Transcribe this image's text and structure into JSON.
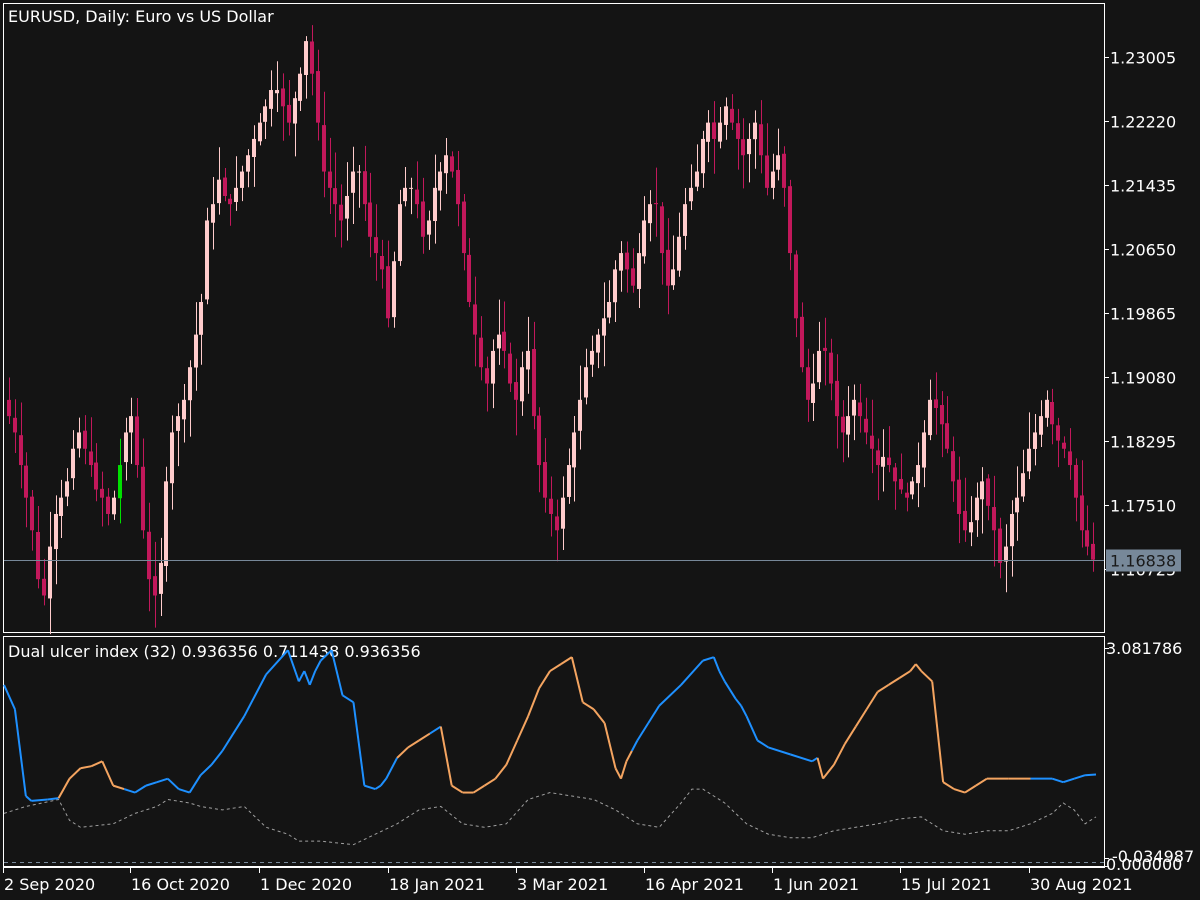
{
  "window": {
    "symbol_title": "EURUSD, Daily:  Euro vs US Dollar"
  },
  "colors": {
    "background": "#141414",
    "frame": "#ffffff",
    "bull_candle": "#ffcccc",
    "bear_candle": "#c2185b",
    "doji_candle": "#00e000",
    "price_line": "#778899",
    "price_tag_bg": "#778899",
    "ulcer_up": "#1e90ff",
    "ulcer_down": "#f4a460",
    "ulcer_dotted": "#a0a0a0",
    "zero_line": "#778899"
  },
  "indicator": {
    "label": "Dual ulcer index (32) 0.936356 0.711438 0.936356",
    "name": "Dual ulcer index",
    "period": 32,
    "values": [
      0.936356,
      0.711438,
      0.936356
    ]
  },
  "chart_data": [
    {
      "type": "candlestick",
      "title": "EURUSD, Daily:  Euro vs US Dollar",
      "ylabel": "",
      "ylim": [
        1.1602,
        1.2375
      ],
      "yticks": [
        "1.23005",
        "1.22220",
        "1.21435",
        "1.20650",
        "1.19865",
        "1.19080",
        "1.18295",
        "1.17510",
        "1.16725"
      ],
      "ytick_values": [
        1.23005,
        1.2222,
        1.21435,
        1.2065,
        1.19865,
        1.1908,
        1.18295,
        1.1751,
        1.16725
      ],
      "current_price": "1.16838",
      "current_price_value": 1.16838,
      "xticks": [
        "2 Sep 2020",
        "16 Oct 2020",
        "1 Dec 2020",
        "18 Jan 2021",
        "3 Mar 2021",
        "16 Apr 2021",
        "1 Jun 2021",
        "15 Jul 2021",
        "30 Aug 2021"
      ],
      "grid": false,
      "close_path": [
        1.186,
        1.184,
        1.18,
        1.176,
        1.172,
        1.166,
        1.164,
        1.17,
        1.174,
        1.176,
        1.178,
        1.182,
        1.184,
        1.182,
        1.18,
        1.177,
        1.176,
        1.174,
        1.176,
        1.18,
        1.184,
        1.186,
        1.18,
        1.172,
        1.166,
        1.164,
        1.168,
        1.178,
        1.184,
        1.186,
        1.188,
        1.192,
        1.196,
        1.2,
        1.21,
        1.212,
        1.215,
        1.213,
        1.212,
        1.214,
        1.216,
        1.218,
        1.22,
        1.222,
        1.224,
        1.226,
        1.226,
        1.224,
        1.222,
        1.225,
        1.228,
        1.232,
        1.228,
        1.222,
        1.216,
        1.214,
        1.212,
        1.21,
        1.213,
        1.216,
        1.216,
        1.212,
        1.208,
        1.206,
        1.204,
        1.198,
        1.205,
        1.212,
        1.214,
        1.214,
        1.212,
        1.208,
        1.21,
        1.214,
        1.216,
        1.218,
        1.216,
        1.212,
        1.206,
        1.2,
        1.196,
        1.192,
        1.19,
        1.194,
        1.196,
        1.194,
        1.19,
        1.188,
        1.192,
        1.194,
        1.186,
        1.18,
        1.176,
        1.174,
        1.172,
        1.176,
        1.18,
        1.184,
        1.188,
        1.192,
        1.194,
        1.196,
        1.198,
        1.2,
        1.204,
        1.206,
        1.204,
        1.202,
        1.206,
        1.21,
        1.212,
        1.212,
        1.206,
        1.202,
        1.204,
        1.208,
        1.212,
        1.214,
        1.216,
        1.22,
        1.222,
        1.22,
        1.222,
        1.224,
        1.222,
        1.22,
        1.218,
        1.22,
        1.222,
        1.218,
        1.214,
        1.216,
        1.218,
        1.214,
        1.206,
        1.198,
        1.192,
        1.188,
        1.19,
        1.194,
        1.194,
        1.19,
        1.186,
        1.184,
        1.186,
        1.188,
        1.186,
        1.184,
        1.182,
        1.18,
        1.181,
        1.18,
        1.178,
        1.177,
        1.176,
        1.178,
        1.18,
        1.184,
        1.188,
        1.187,
        1.185,
        1.182,
        1.178,
        1.174,
        1.172,
        1.173,
        1.176,
        1.178,
        1.175,
        1.172,
        1.168,
        1.17,
        1.174,
        1.176,
        1.179,
        1.182,
        1.184,
        1.186,
        1.188,
        1.185,
        1.183,
        1.182,
        1.18,
        1.176,
        1.172,
        1.17,
        1.1684
      ]
    },
    {
      "type": "line",
      "title": "Dual ulcer index (32) 0.936356 0.711438 0.936356",
      "ylim": [
        -0.034987,
        3.081786
      ],
      "yticks": [
        "3.081786",
        "-0.034987",
        "0.000000"
      ],
      "ytick_values": [
        3.081786,
        -0.034987,
        0.0
      ],
      "series": [
        {
          "name": "ulcer (up-colored blue / down-colored orange)",
          "x_fraction": [
            0.0,
            0.01,
            0.02,
            0.025,
            0.04,
            0.05,
            0.06,
            0.07,
            0.08,
            0.09,
            0.1,
            0.11,
            0.12,
            0.13,
            0.14,
            0.15,
            0.16,
            0.17,
            0.18,
            0.19,
            0.2,
            0.22,
            0.24,
            0.26,
            0.27,
            0.275,
            0.28,
            0.285,
            0.29,
            0.3,
            0.31,
            0.32,
            0.33,
            0.34,
            0.345,
            0.35,
            0.36,
            0.37,
            0.38,
            0.39,
            0.4,
            0.41,
            0.42,
            0.43,
            0.44,
            0.45,
            0.46,
            0.47,
            0.48,
            0.49,
            0.5,
            0.51,
            0.52,
            0.53,
            0.54,
            0.55,
            0.56,
            0.565,
            0.57,
            0.575,
            0.58,
            0.59,
            0.6,
            0.62,
            0.64,
            0.65,
            0.655,
            0.66,
            0.67,
            0.675,
            0.68,
            0.69,
            0.7,
            0.72,
            0.74,
            0.745,
            0.75,
            0.76,
            0.77,
            0.78,
            0.79,
            0.8,
            0.81,
            0.82,
            0.83,
            0.835,
            0.84,
            0.85,
            0.86,
            0.87,
            0.88,
            0.89,
            0.9,
            0.92,
            0.94,
            0.96,
            0.97,
            0.98,
            0.99,
            1.0
          ],
          "values": [
            2.55,
            2.2,
            0.95,
            0.88,
            0.9,
            0.92,
            1.2,
            1.35,
            1.38,
            1.45,
            1.1,
            1.05,
            1.0,
            1.1,
            1.15,
            1.2,
            1.05,
            1.0,
            1.25,
            1.4,
            1.6,
            2.1,
            2.7,
            3.05,
            2.6,
            2.75,
            2.55,
            2.75,
            2.9,
            3.05,
            2.4,
            2.3,
            1.1,
            1.05,
            1.1,
            1.2,
            1.5,
            1.65,
            1.75,
            1.85,
            1.95,
            1.1,
            1.0,
            1.0,
            1.1,
            1.2,
            1.4,
            1.75,
            2.1,
            2.5,
            2.75,
            2.85,
            2.95,
            2.3,
            2.2,
            2.0,
            1.35,
            1.2,
            1.45,
            1.6,
            1.75,
            2.0,
            2.25,
            2.55,
            2.9,
            2.95,
            2.75,
            2.6,
            2.35,
            2.25,
            2.1,
            1.75,
            1.65,
            1.55,
            1.45,
            1.5,
            1.2,
            1.4,
            1.7,
            1.95,
            2.2,
            2.45,
            2.55,
            2.65,
            2.75,
            2.85,
            2.75,
            2.6,
            1.15,
            1.05,
            1.0,
            1.1,
            1.2,
            1.2,
            1.2,
            1.2,
            1.15,
            1.2,
            1.25,
            1.26
          ]
        },
        {
          "name": "ulcer baseline (dotted)",
          "x_fraction": [
            0.0,
            0.02,
            0.05,
            0.06,
            0.07,
            0.1,
            0.12,
            0.14,
            0.15,
            0.17,
            0.18,
            0.2,
            0.22,
            0.24,
            0.26,
            0.27,
            0.29,
            0.32,
            0.34,
            0.36,
            0.38,
            0.4,
            0.42,
            0.44,
            0.46,
            0.48,
            0.5,
            0.52,
            0.54,
            0.56,
            0.58,
            0.6,
            0.62,
            0.63,
            0.64,
            0.66,
            0.68,
            0.7,
            0.72,
            0.74,
            0.76,
            0.78,
            0.8,
            0.82,
            0.84,
            0.86,
            0.88,
            0.9,
            0.92,
            0.94,
            0.96,
            0.97,
            0.98,
            0.99,
            1.0
          ],
          "values": [
            0.7,
            0.8,
            0.9,
            0.6,
            0.5,
            0.55,
            0.7,
            0.8,
            0.9,
            0.85,
            0.8,
            0.75,
            0.8,
            0.5,
            0.4,
            0.3,
            0.3,
            0.25,
            0.4,
            0.55,
            0.75,
            0.8,
            0.55,
            0.5,
            0.55,
            0.9,
            1.0,
            0.95,
            0.9,
            0.75,
            0.55,
            0.5,
            0.85,
            1.05,
            1.05,
            0.85,
            0.55,
            0.4,
            0.35,
            0.35,
            0.45,
            0.5,
            0.55,
            0.62,
            0.65,
            0.45,
            0.4,
            0.45,
            0.45,
            0.55,
            0.7,
            0.85,
            0.75,
            0.55,
            0.65
          ]
        }
      ]
    }
  ]
}
